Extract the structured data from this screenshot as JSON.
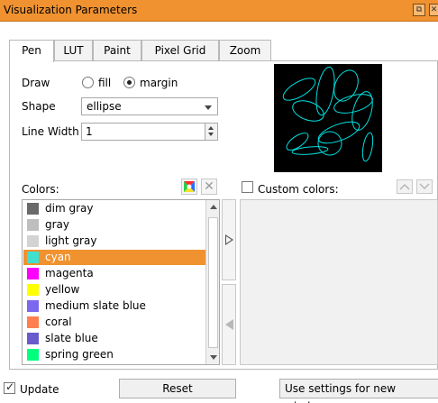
{
  "window": {
    "title": "Visualization Parameters"
  },
  "tabs": [
    {
      "label": "Pen"
    },
    {
      "label": "LUT"
    },
    {
      "label": "Paint"
    },
    {
      "label": "Pixel Grid"
    },
    {
      "label": "Zoom"
    }
  ],
  "active_tab": "Pen",
  "pen": {
    "draw_label": "Draw",
    "draw_options": [
      {
        "label": "fill",
        "selected": false
      },
      {
        "label": "margin",
        "selected": true
      }
    ],
    "shape_label": "Shape",
    "shape_value": "ellipse",
    "line_width_label": "Line Width",
    "line_width_value": "1",
    "preview_color": "#00e0e0"
  },
  "colors": {
    "label": "Colors:",
    "items": [
      {
        "name": "dim gray",
        "color": "#696969"
      },
      {
        "name": "gray",
        "color": "#bebebe"
      },
      {
        "name": "light gray",
        "color": "#d3d3d3"
      },
      {
        "name": "cyan",
        "color": "#40e0d0",
        "selected": true
      },
      {
        "name": "magenta",
        "color": "#ff00ff"
      },
      {
        "name": "yellow",
        "color": "#ffff00"
      },
      {
        "name": "medium slate blue",
        "color": "#7b68ee"
      },
      {
        "name": "coral",
        "color": "#ff7f50"
      },
      {
        "name": "slate blue",
        "color": "#6a5acd"
      },
      {
        "name": "spring green",
        "color": "#00ff7f"
      }
    ]
  },
  "custom_colors": {
    "label": "Custom colors:",
    "checked": false
  },
  "footer": {
    "update_label": "Update",
    "update_checked": true,
    "reset_label": "Reset",
    "new_windows_label": "Use settings for new windows"
  },
  "icons": {
    "color_picker": "color-picker-icon",
    "delete": "delete-icon",
    "move_up": "up-icon",
    "move_down": "down-icon",
    "float": "float-window-icon",
    "close": "close-icon"
  }
}
